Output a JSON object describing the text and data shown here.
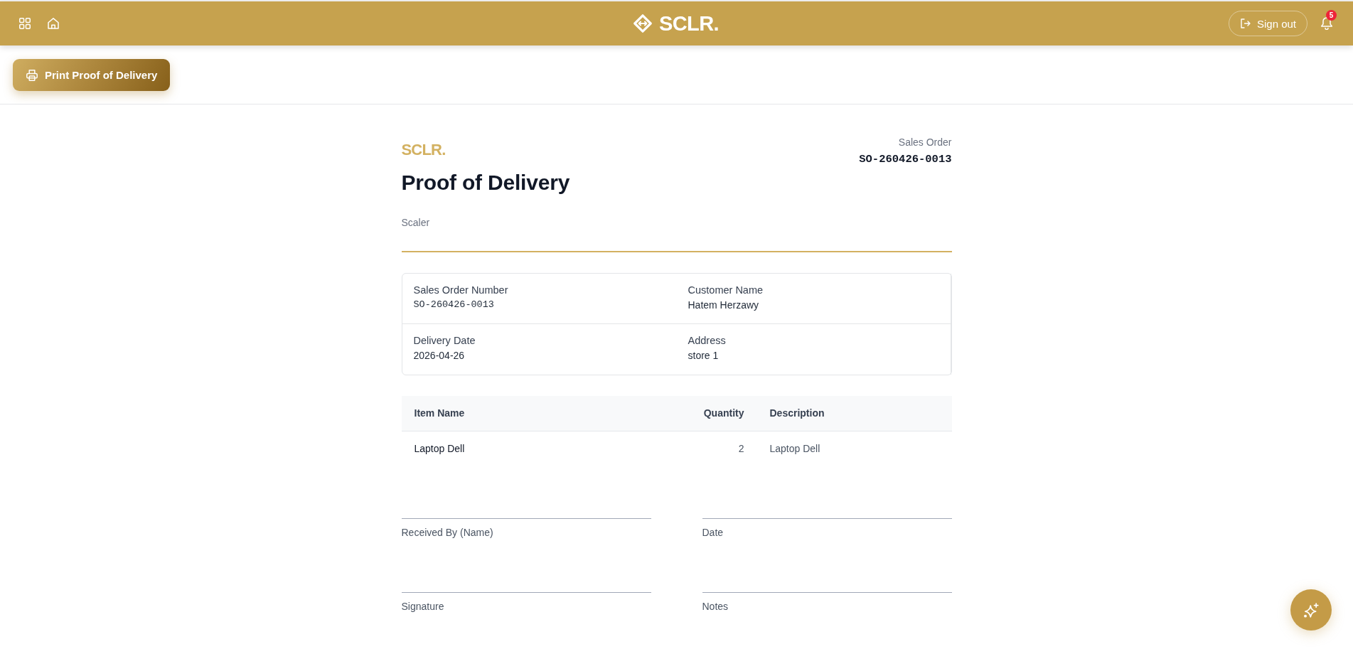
{
  "top_bar": {
    "logo": "SCLR.",
    "sign_out": "Sign out",
    "notification_count": "5"
  },
  "toolbar": {
    "print_button": "Print Proof of Delivery"
  },
  "document": {
    "brand": "SCLR.",
    "title": "Proof of Delivery",
    "company": "Scaler",
    "order_label": "Sales Order",
    "order_number": "SO-260426-0013",
    "details": [
      {
        "label": "Sales Order Number",
        "value": "SO-260426-0013",
        "kind": "code"
      },
      {
        "label": "Customer Name",
        "value": "Hatem Herzawy",
        "kind": "text"
      },
      {
        "label": "Delivery Date",
        "value": "2026-04-26",
        "kind": "text"
      },
      {
        "label": "Address",
        "value": "store 1",
        "kind": "text"
      }
    ],
    "items": {
      "columns": [
        {
          "label": "Item Name",
          "kind": "name"
        },
        {
          "label": "Quantity",
          "kind": "number"
        },
        {
          "label": "Description",
          "kind": "text"
        }
      ],
      "rows": [
        [
          "Laptop Dell",
          "2",
          "Laptop Dell"
        ]
      ]
    },
    "signature_fields": [
      "Received By (Name)",
      "Date",
      "Signature",
      "Notes"
    ]
  }
}
